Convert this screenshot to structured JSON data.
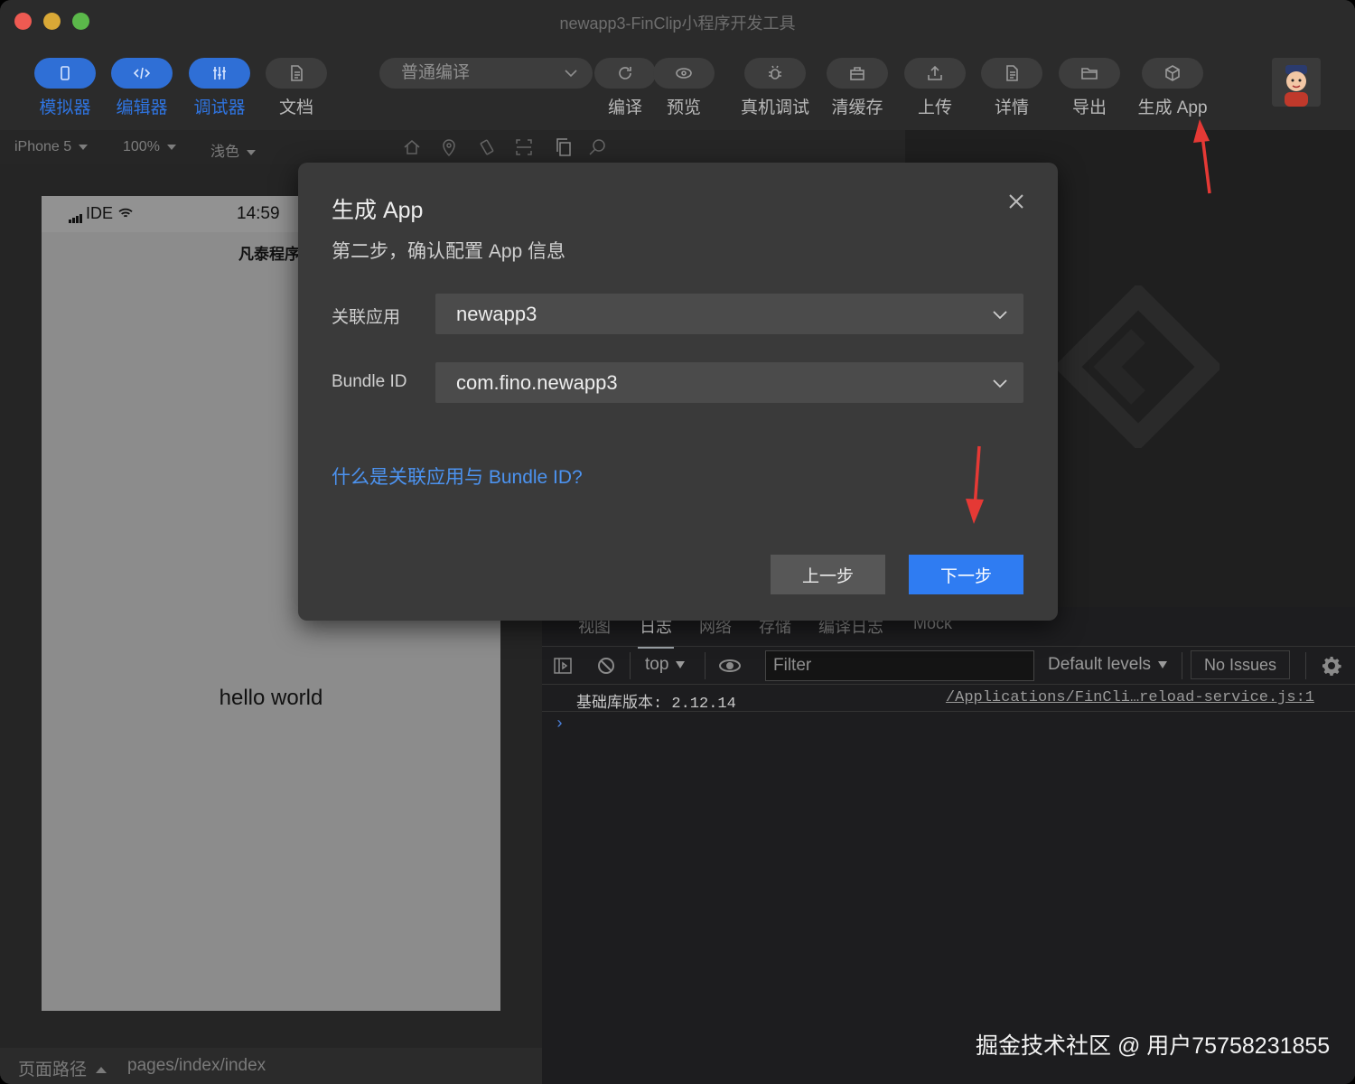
{
  "window": {
    "title": "newapp3-FinClip小程序开发工具"
  },
  "toolbar": {
    "left_buttons": [
      {
        "label": "模拟器",
        "icon": "phone-icon",
        "active": true
      },
      {
        "label": "编辑器",
        "icon": "code-icon",
        "active": true
      },
      {
        "label": "调试器",
        "icon": "sliders-icon",
        "active": true
      },
      {
        "label": "文档",
        "icon": "document-icon",
        "active": false
      }
    ],
    "compile_mode": "普通编译",
    "right_buttons": [
      {
        "label": "编译",
        "icon": "refresh-icon"
      },
      {
        "label": "预览",
        "icon": "eye-icon"
      },
      {
        "label": "真机调试",
        "icon": "bug-icon"
      },
      {
        "label": "清缓存",
        "icon": "cache-icon"
      },
      {
        "label": "上传",
        "icon": "upload-icon"
      },
      {
        "label": "详情",
        "icon": "details-icon"
      },
      {
        "label": "导出",
        "icon": "folder-icon"
      },
      {
        "label": "生成 App",
        "icon": "box-icon"
      }
    ],
    "avatar_icon": "user-avatar-icon"
  },
  "simulator": {
    "device": "iPhone 5",
    "zoom": "100%",
    "theme": "浅色",
    "status_carrier": "IDE",
    "status_time": "14:59",
    "nav_title": "凡泰程序",
    "content_text": "hello world",
    "path_label": "页面路径",
    "path_value": "pages/index/index"
  },
  "devtools": {
    "tabs": [
      "视图",
      "日志",
      "网络",
      "存储",
      "编译日志",
      "Mock"
    ],
    "active_tab": "日志",
    "context": "top",
    "filter_placeholder": "Filter",
    "levels": "Default levels",
    "issues": "No Issues",
    "log_message": "基础库版本: 2.12.14",
    "log_source": "/Applications/FinCli…reload-service.js:1",
    "prompt": "›"
  },
  "modal": {
    "title": "生成 App",
    "subtitle": "第二步，确认配置 App 信息",
    "app_label": "关联应用",
    "app_value": "newapp3",
    "bundle_label": "Bundle ID",
    "bundle_value": "com.fino.newapp3",
    "help_link": "什么是关联应用与 Bundle ID?",
    "prev_button": "上一步",
    "next_button": "下一步"
  },
  "watermark": "掘金技术社区 @ 用户75758231855",
  "colors": {
    "accent_blue": "#2f7cf2",
    "active_tab_blue": "#2f6fd6",
    "link_blue": "#4c93f0",
    "annotation_red": "#e53935"
  }
}
